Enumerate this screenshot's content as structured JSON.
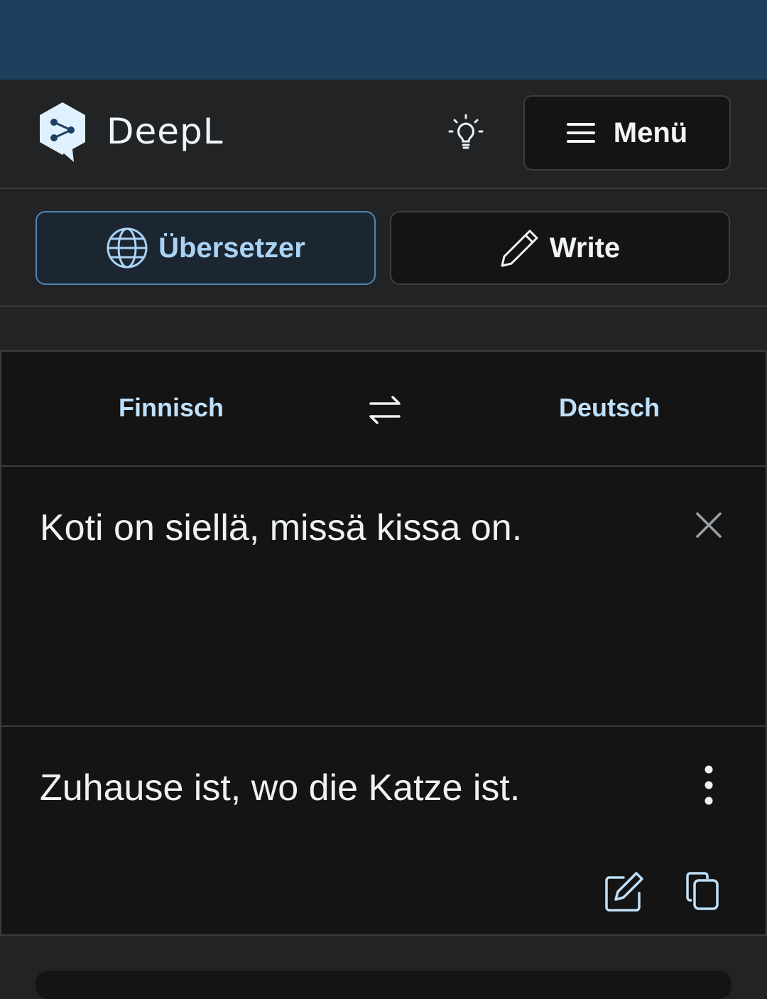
{
  "header": {
    "brand": "DeepL",
    "menu_label": "Menü",
    "logo_icon": "deepl-logo-icon",
    "theme_icon": "lightbulb-icon",
    "menu_icon": "hamburger-icon"
  },
  "modes": {
    "translator_label": "Übersetzer",
    "write_label": "Write",
    "active": "translator"
  },
  "translator": {
    "source_lang": "Finnisch",
    "target_lang": "Deutsch",
    "source_text": "Koti on siellä, missä kissa on.",
    "target_text": "Zuhause ist, wo die Katze ist."
  },
  "colors": {
    "top_strip": "#1f3f5e",
    "background": "#222324",
    "panel": "#141414",
    "accent": "#a9d3f5"
  }
}
